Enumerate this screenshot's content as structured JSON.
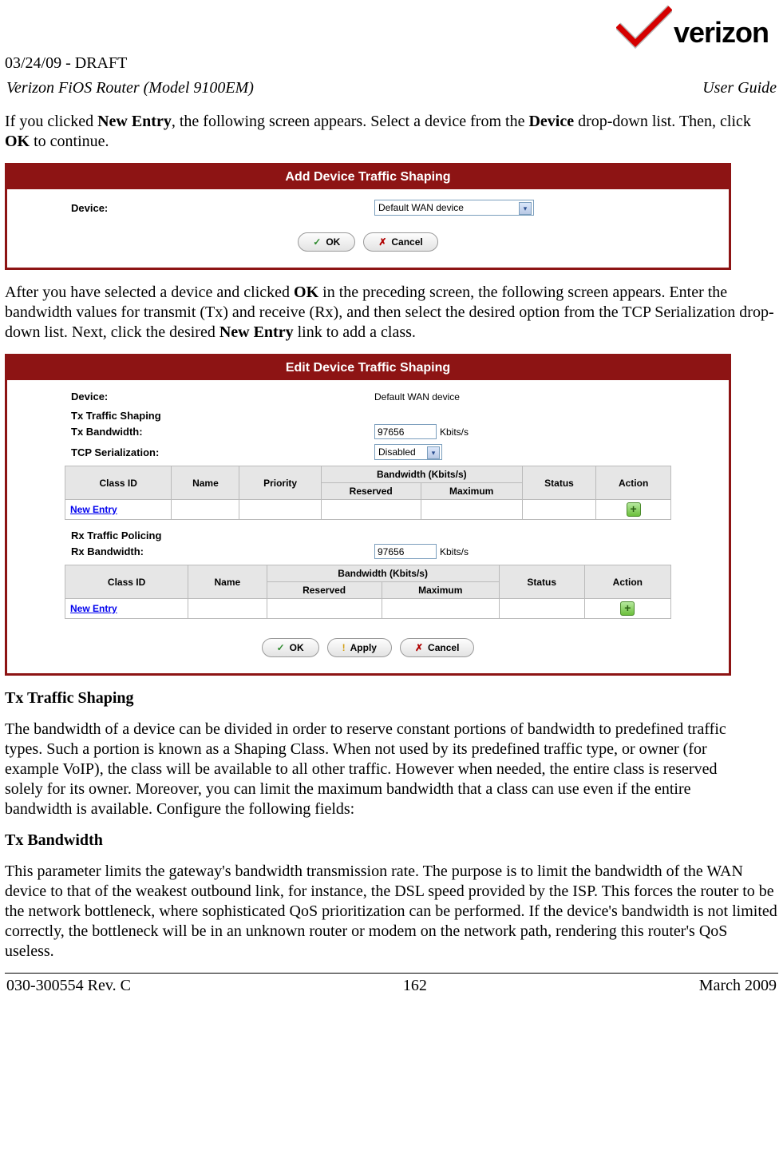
{
  "header": {
    "draft_line": "03/24/09 - DRAFT",
    "doc_title_left": "Verizon FiOS Router (Model 9100EM)",
    "doc_title_right": "User Guide",
    "logo_text": "verizon"
  },
  "text": {
    "p1_a": "If you clicked ",
    "p1_b": "New Entry",
    "p1_c": ", the following screen appears. Select a device from the ",
    "p1_d": "Device",
    "p1_e": " drop-down list. Then, click ",
    "p1_f": "OK",
    "p1_g": " to continue.",
    "p2_a": "After you have selected a device and clicked ",
    "p2_b": "OK",
    "p2_c": " in the preceding screen, the following screen appears. Enter the bandwidth values for transmit (Tx) and receive (Rx), and then select the desired option from the TCP Serialization drop-down list. Next, click the desired ",
    "p2_d": "New Entry",
    "p2_e": " link to add a class.",
    "tx_shaping_heading": "Tx Traffic Shaping",
    "tx_shaping_body": "The bandwidth of a device can be divided in order to reserve constant portions of bandwidth to predefined traffic types. Such a portion is known as a Shaping Class. When not used by its predefined traffic type, or owner (for example VoIP), the class will be available to all other traffic. However when needed, the entire class is reserved solely for its owner. Moreover, you can limit the maximum bandwidth that a class can use even if the entire bandwidth is available. Configure the following fields:",
    "tx_bw_heading": "Tx Bandwidth",
    "tx_bw_body": "This parameter limits the gateway's bandwidth transmission rate. The purpose is to limit the bandwidth of the WAN device to that of the weakest outbound link, for instance, the DSL speed provided by the ISP. This forces the router to be the network bottleneck, where sophisticated QoS prioritization can be performed. If the device's bandwidth is not limited correctly, the bottleneck will be in an unknown router or modem on the network path, rendering this router's QoS useless."
  },
  "panel1": {
    "title": "Add Device Traffic Shaping",
    "device_label": "Device:",
    "device_value": "Default WAN device",
    "btn_ok": "OK",
    "btn_cancel": "Cancel"
  },
  "panel2": {
    "title": "Edit Device Traffic Shaping",
    "device_label": "Device:",
    "device_value": "Default WAN device",
    "tx_section": "Tx Traffic Shaping",
    "tx_bw_label": "Tx Bandwidth:",
    "tx_bw_value": "97656",
    "tx_bw_unit": "Kbits/s",
    "tcp_ser_label": "TCP Serialization:",
    "tcp_ser_value": "Disabled",
    "table_headers": {
      "class_id": "Class ID",
      "name": "Name",
      "priority": "Priority",
      "bw_group": "Bandwidth (Kbits/s)",
      "reserved": "Reserved",
      "maximum": "Maximum",
      "status": "Status",
      "action": "Action"
    },
    "new_entry": "New Entry",
    "rx_section": "Rx Traffic Policing",
    "rx_bw_label": "Rx Bandwidth:",
    "rx_bw_value": "97656",
    "rx_bw_unit": "Kbits/s",
    "btn_ok": "OK",
    "btn_apply": "Apply",
    "btn_cancel": "Cancel"
  },
  "footer": {
    "left": "030-300554 Rev. C",
    "center": "162",
    "right": "March 2009"
  }
}
